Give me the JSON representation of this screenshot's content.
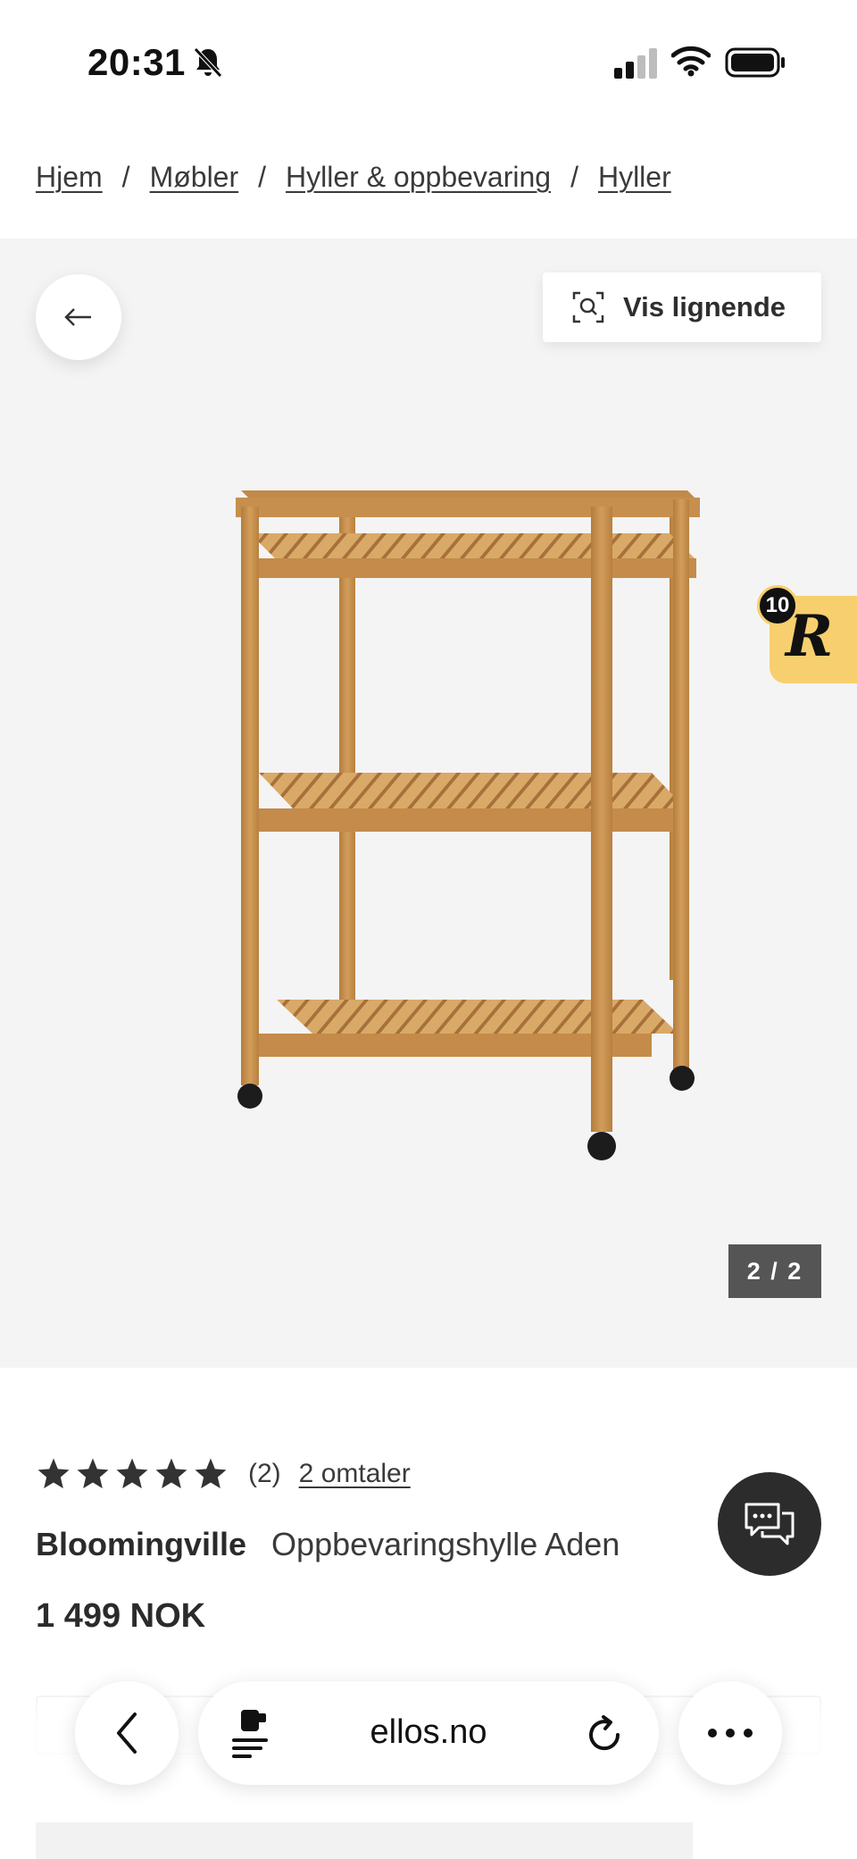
{
  "status_bar": {
    "time": "20:31",
    "icons": [
      "bell-slash-icon",
      "cellular-signal-icon",
      "wifi-icon",
      "battery-icon"
    ]
  },
  "breadcrumb": {
    "items": [
      {
        "label": "Hjem"
      },
      {
        "label": "Møbler"
      },
      {
        "label": "Hyller & oppbevaring"
      },
      {
        "label": "Hyller"
      }
    ],
    "separator": "/"
  },
  "gallery": {
    "back_icon": "arrow-left-icon",
    "similar_button_label": "Vis lignende",
    "similar_icon": "visual-search-icon",
    "image_counter": "2 / 2",
    "rewards_count": "10",
    "rewards_letter": "R"
  },
  "product": {
    "rating_stars": 5,
    "rating_count": "(2)",
    "reviews_link": "2 omtaler",
    "brand": "Bloomingville",
    "name": "Oppbevaringshylle Aden",
    "price": "1 499 NOK"
  },
  "chat": {
    "icon": "chat-bubbles-icon"
  },
  "browser": {
    "url": "ellos.no",
    "back_icon": "chevron-left-icon",
    "reader_icon": "page-menu-icon",
    "reload_icon": "reload-icon",
    "more_icon": "more-dots-icon"
  },
  "colors": {
    "gallery_bg": "#f4f4f4",
    "rewards_badge": "#f8cf6e",
    "counter_bg": "#555555",
    "chat_bg": "#2c2c2c",
    "wood": "#c8934f"
  }
}
